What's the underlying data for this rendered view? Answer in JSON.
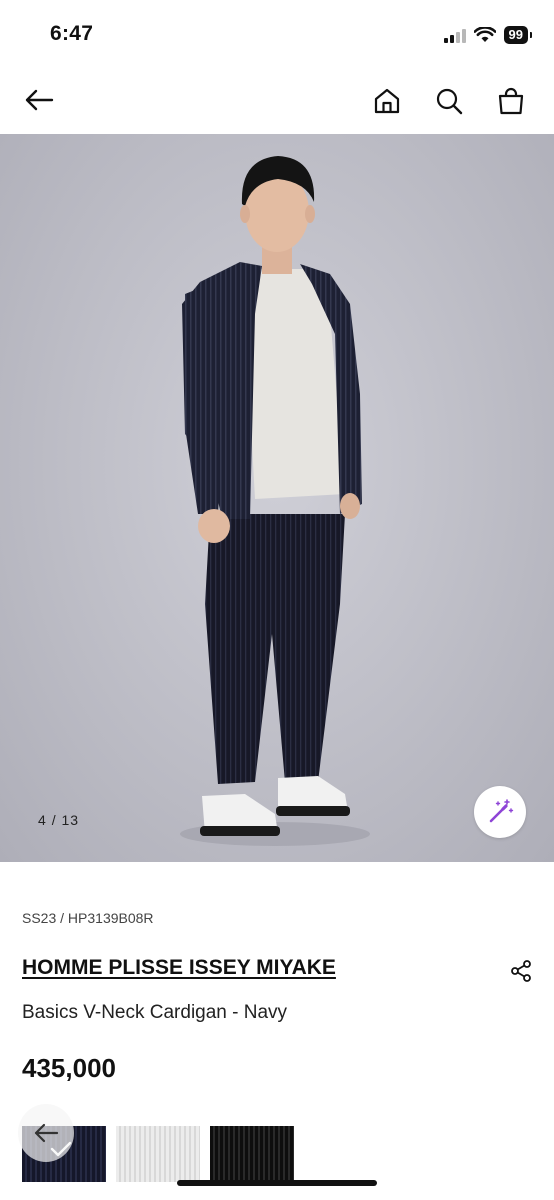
{
  "status_bar": {
    "time": "6:47",
    "battery": "99"
  },
  "nav": {
    "back_icon": "arrow-left-icon",
    "icons": [
      "home-icon",
      "search-icon",
      "shopping-bag-icon"
    ]
  },
  "gallery": {
    "current": "4",
    "separator": "/",
    "total": "13"
  },
  "product": {
    "code": "SS23 / HP3139B08R",
    "brand": "HOMME PLISSE ISSEY MIYAKE",
    "name": "Basics V-Neck Cardigan - Navy",
    "price": "435,000"
  },
  "swatches": [
    {
      "color": "#15172a",
      "selected": true
    },
    {
      "color": "#e6e6e6",
      "selected": false
    },
    {
      "color": "#111111",
      "selected": false
    }
  ],
  "colors": {
    "accent": "#8e44d6",
    "text": "#111111"
  }
}
